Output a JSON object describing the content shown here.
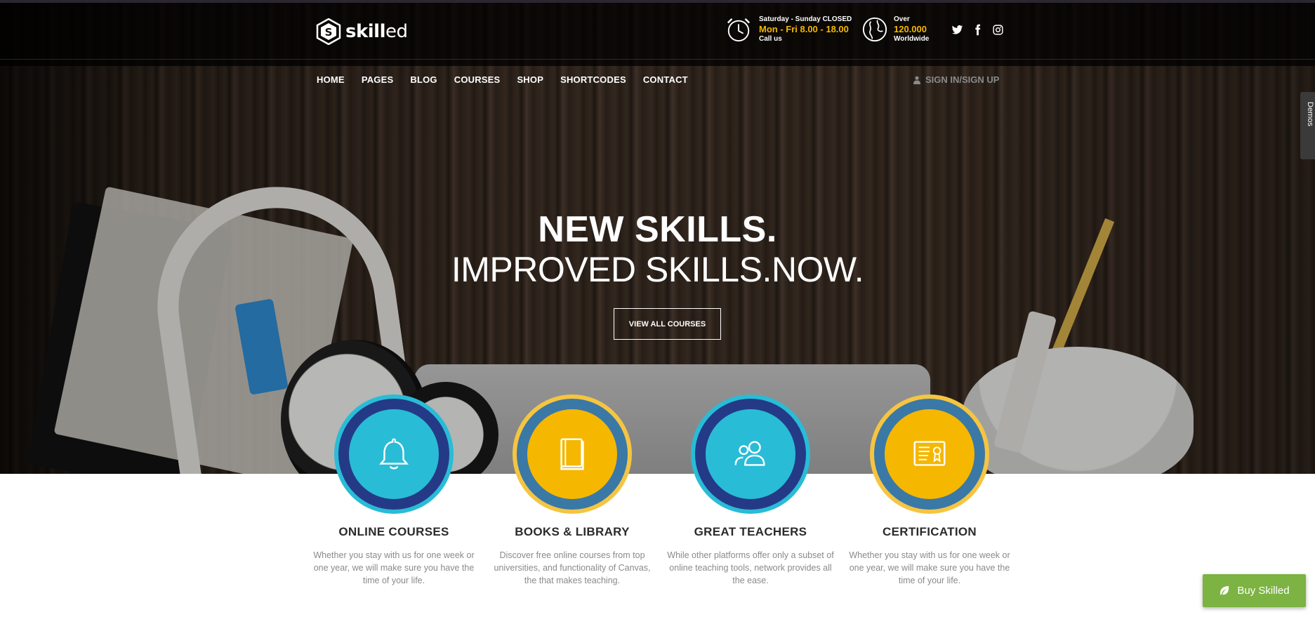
{
  "logo": {
    "bold": "skill",
    "light": "ed"
  },
  "header": {
    "hours": {
      "line1": "Saturday - Sunday CLOSED",
      "line2": "Mon - Fri 8.00 - 18.00",
      "line3": "Call us"
    },
    "reach": {
      "line1": "Over",
      "line2": "120.000",
      "line3": "Worldwide"
    },
    "social": [
      "twitter-icon",
      "facebook-icon",
      "instagram-icon"
    ]
  },
  "nav": {
    "items": [
      {
        "label": "HOME"
      },
      {
        "label": "PAGES"
      },
      {
        "label": "BLOG"
      },
      {
        "label": "COURSES"
      },
      {
        "label": "SHOP"
      },
      {
        "label": "SHORTCODES"
      },
      {
        "label": "CONTACT"
      }
    ],
    "signin": "SIGN IN/SIGN UP"
  },
  "side_tab": {
    "label": "Demos"
  },
  "hero": {
    "title": "NEW SKILLS.",
    "subtitle": "IMPROVED SKILLS.NOW.",
    "button": "VIEW ALL COURSES"
  },
  "features": [
    {
      "title": "ONLINE COURSES",
      "desc": "Whether you stay with us for one week or one year, we will make sure you have the time of your life.",
      "icon": "bell-icon"
    },
    {
      "title": "BOOKS & LIBRARY",
      "desc": "Discover free online courses from top universities, and functionality of Canvas, the that makes teaching.",
      "icon": "book-icon"
    },
    {
      "title": "GREAT TEACHERS",
      "desc": "While other platforms offer only a subset of online teaching tools, network provides all the ease.",
      "icon": "users-icon"
    },
    {
      "title": "CERTIFICATION",
      "desc": "Whether you stay with us for one week or one year, we will make sure you have the time of your life.",
      "icon": "certificate-icon"
    }
  ],
  "buy": {
    "label": "Buy Skilled"
  },
  "colors": {
    "accent_yellow": "#f5b700",
    "accent_cyan": "#29bcd6",
    "ring_navy": "#243a87",
    "ring_blue": "#3a78a6",
    "buy_green": "#7cb342"
  }
}
